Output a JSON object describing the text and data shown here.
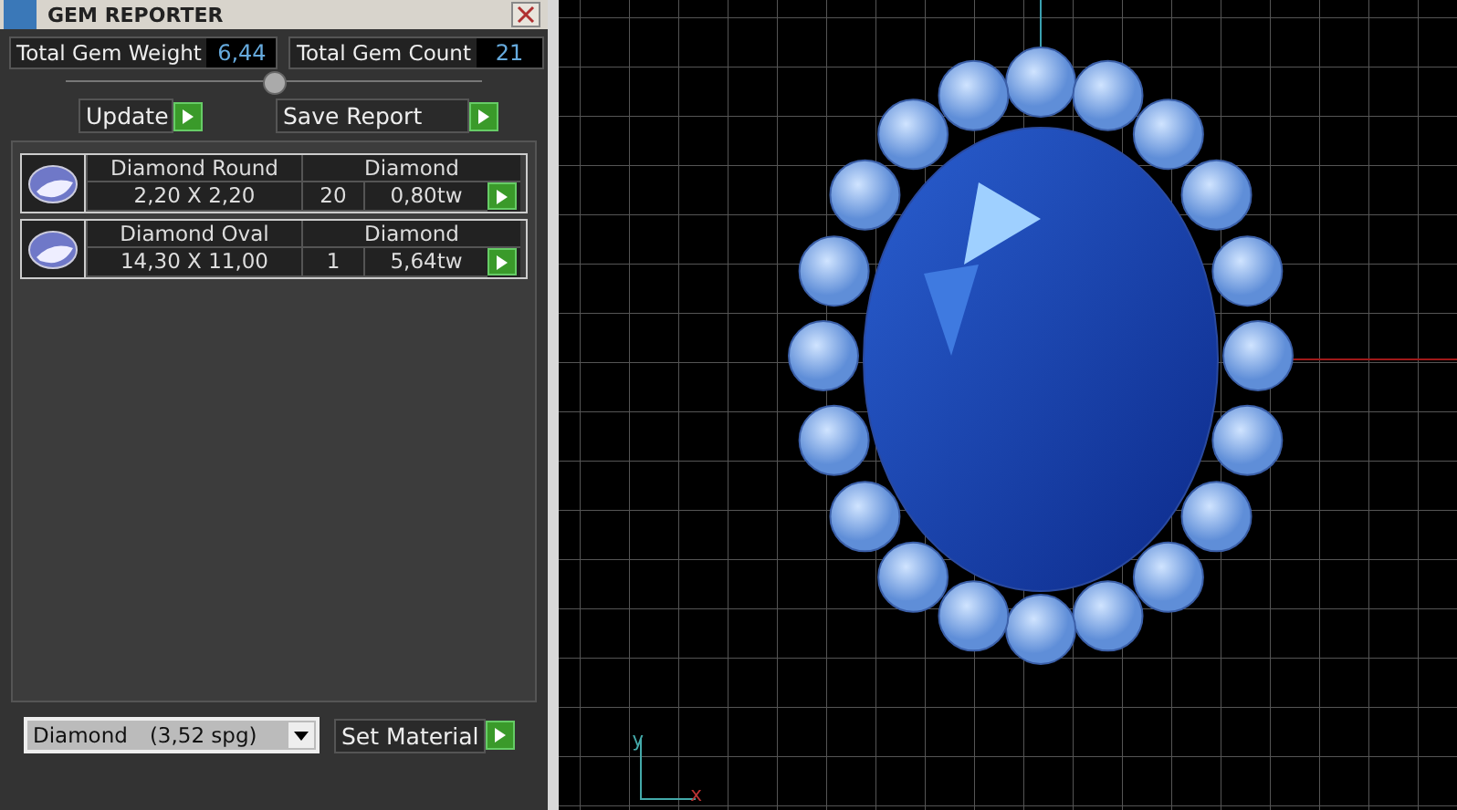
{
  "window": {
    "title": "GEM REPORTER"
  },
  "totals": [
    {
      "label": "Total Gem Weight",
      "value": "6,44"
    },
    {
      "label": "Total Gem Count",
      "value": "21"
    }
  ],
  "buttons": [
    {
      "label": "Update"
    },
    {
      "label": "Save Report"
    }
  ],
  "gems": [
    {
      "name": "Diamond Round",
      "material": "Diamond",
      "size": "2,20 X 2,20",
      "count": "20",
      "weight": "0,80tw"
    },
    {
      "name": "Diamond Oval",
      "material": "Diamond",
      "size": "14,30 X 11,00",
      "count": "1",
      "weight": "5,64tw"
    }
  ],
  "material_select": {
    "value": "Diamond",
    "density": "(3,52 spg)"
  },
  "set_button": {
    "label": "Set Material"
  },
  "axes": {
    "x": "x",
    "y": "y"
  }
}
